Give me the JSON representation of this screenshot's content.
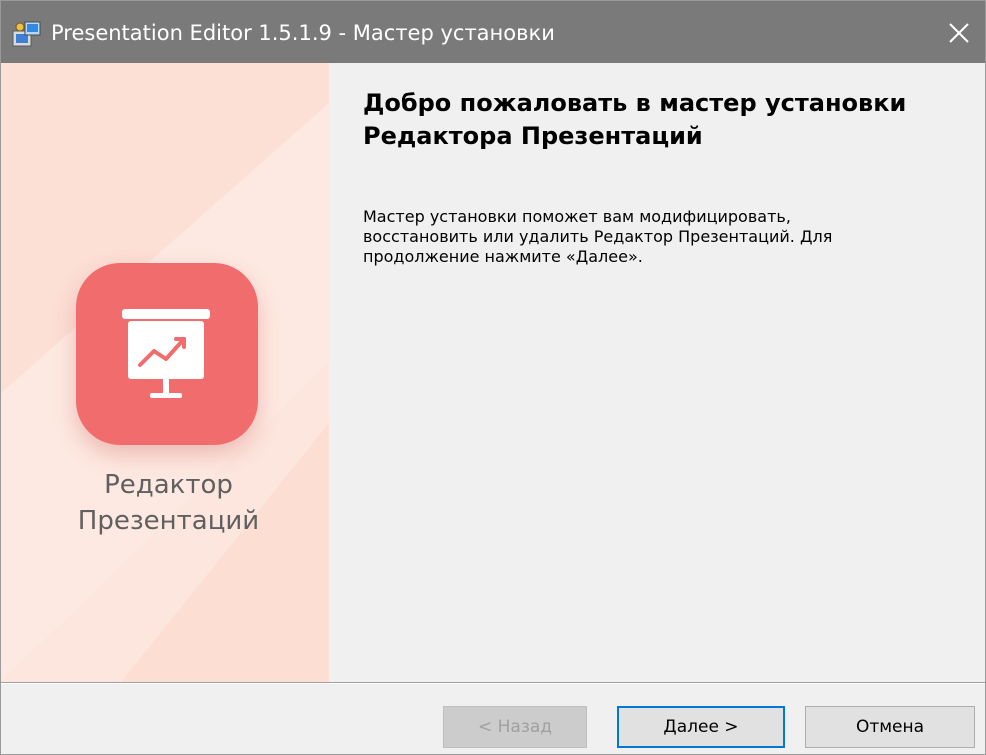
{
  "window": {
    "title": "Presentation Editor 1.5.1.9 - Мастер установки",
    "icon": "installer-icon",
    "close_icon": "close-icon"
  },
  "banner": {
    "logo_icon": "presentation-board-icon",
    "caption_line1": "Редактор",
    "caption_line2": "Презентаций",
    "accent_color": "#f16c6c",
    "background_color": "#fce6de"
  },
  "content": {
    "title_line1": "Добро пожаловать в мастер установки",
    "title_line2": "Редактора Презентаций",
    "body_line1": "Мастер установки поможет вам модифицировать,",
    "body_line2": "восстановить или удалить Редактор Презентаций. Для",
    "body_line3": "продолжение нажмите «Далее»."
  },
  "buttons": {
    "back_label": "< Назад",
    "next_label": "Далее >",
    "cancel_label": "Отмена"
  }
}
